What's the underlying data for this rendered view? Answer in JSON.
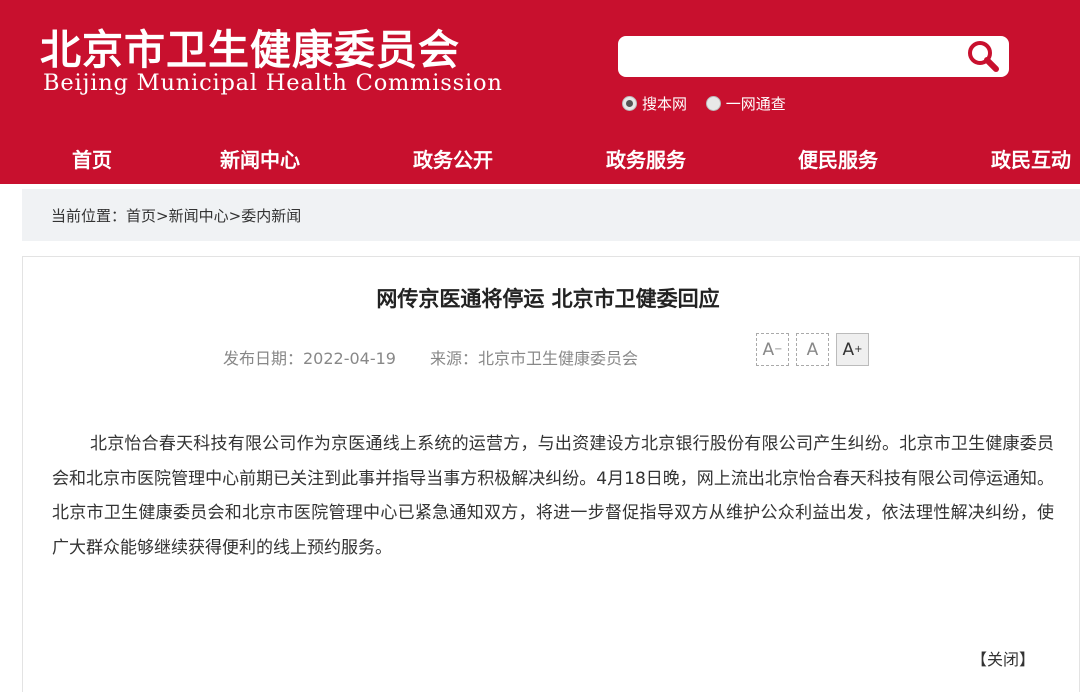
{
  "header": {
    "logo_cn": "北京市卫生健康委员会",
    "logo_en": "Beijing Municipal Health Commission",
    "brand_color": "#c8102e"
  },
  "search": {
    "value": "",
    "placeholder": "",
    "icon": "search-icon",
    "options": [
      {
        "label": "搜本网",
        "selected": true
      },
      {
        "label": "一网通查",
        "selected": false
      }
    ]
  },
  "nav": {
    "items": [
      {
        "label": "首页"
      },
      {
        "label": "新闻中心"
      },
      {
        "label": "政务公开"
      },
      {
        "label": "政务服务"
      },
      {
        "label": "便民服务"
      },
      {
        "label": "政民互动"
      }
    ]
  },
  "breadcrumb": {
    "prefix": "当前位置：",
    "items": [
      "首页",
      "新闻中心",
      "委内新闻"
    ],
    "separator": ">"
  },
  "article": {
    "title": "网传京医通将停运 北京市卫健委回应",
    "date": "发布日期：2022-04-19",
    "source": "来源：北京市卫生健康委员会",
    "font_controls": {
      "decrease": "A",
      "normal": "A",
      "increase": "A",
      "minus_sign": "−",
      "plus_sign": "+"
    },
    "body": "北京怡合春天科技有限公司作为京医通线上系统的运营方，与出资建设方北京银行股份有限公司产生纠纷。北京市卫生健康委员会和北京市医院管理中心前期已关注到此事并指导当事方积极解决纠纷。4月18日晚，网上流出北京怡合春天科技有限公司停运通知。北京市卫生健康委员会和北京市医院管理中心已紧急通知双方，将进一步督促指导双方从维护公众利益出发，依法理性解决纠纷，使广大群众能够继续获得便利的线上预约服务。",
    "close_label": "【关闭】"
  }
}
